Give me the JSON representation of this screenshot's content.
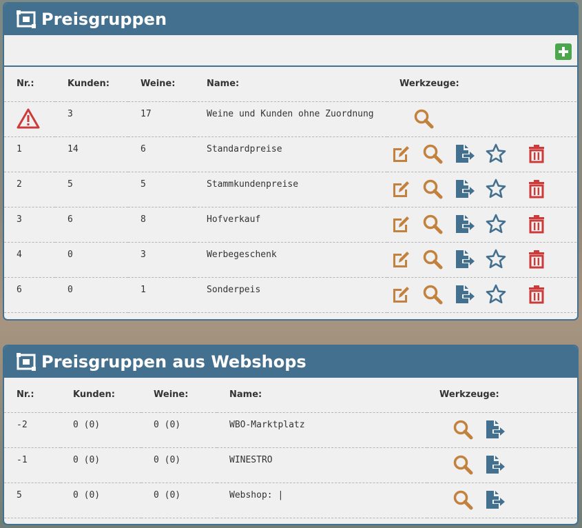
{
  "panel1": {
    "title": "Preisgruppen",
    "headers": {
      "nr": "Nr.:",
      "kunden": "Kunden:",
      "weine": "Weine:",
      "name": "Name:",
      "werkzeuge": "Werkzeuge:"
    },
    "rows": [
      {
        "nr": "",
        "kunden": "3",
        "weine": "17",
        "name": "Weine und Kunden ohne Zuordnung",
        "warning": true
      },
      {
        "nr": "1",
        "kunden": "14",
        "weine": "6",
        "name": "Standardpreise"
      },
      {
        "nr": "2",
        "kunden": "5",
        "weine": "5",
        "name": "Stammkundenpreise"
      },
      {
        "nr": "3",
        "kunden": "6",
        "weine": "8",
        "name": "Hofverkauf"
      },
      {
        "nr": "4",
        "kunden": "0",
        "weine": "3",
        "name": "Werbegeschenk"
      },
      {
        "nr": "6",
        "kunden": "0",
        "weine": "1",
        "name": "Sonderpeis"
      }
    ]
  },
  "panel2": {
    "title": "Preisgruppen aus Webshops",
    "headers": {
      "nr": "Nr.:",
      "kunden": "Kunden:",
      "weine": "Weine:",
      "name": "Name:",
      "werkzeuge": "Werkzeuge:"
    },
    "rows": [
      {
        "nr": "-2",
        "kunden": "0 (0)",
        "weine": "0 (0)",
        "name": "WBO-Marktplatz"
      },
      {
        "nr": "-1",
        "kunden": "0 (0)",
        "weine": "0 (0)",
        "name": "WINESTRO"
      },
      {
        "nr": "5",
        "kunden": "0 (0)",
        "weine": "0 (0)",
        "name": "Webshop: |"
      }
    ]
  },
  "icons": {
    "edit": "edit-icon",
    "search": "search-icon",
    "export": "export-file-icon",
    "star": "star-icon",
    "trash": "trash-icon",
    "warning": "warning-icon",
    "add": "plus-square-icon"
  },
  "colors": {
    "header": "#44708f",
    "gold": "#c2813c",
    "blue": "#44708f",
    "red": "#cc3a3a",
    "green": "#4ca64c"
  }
}
